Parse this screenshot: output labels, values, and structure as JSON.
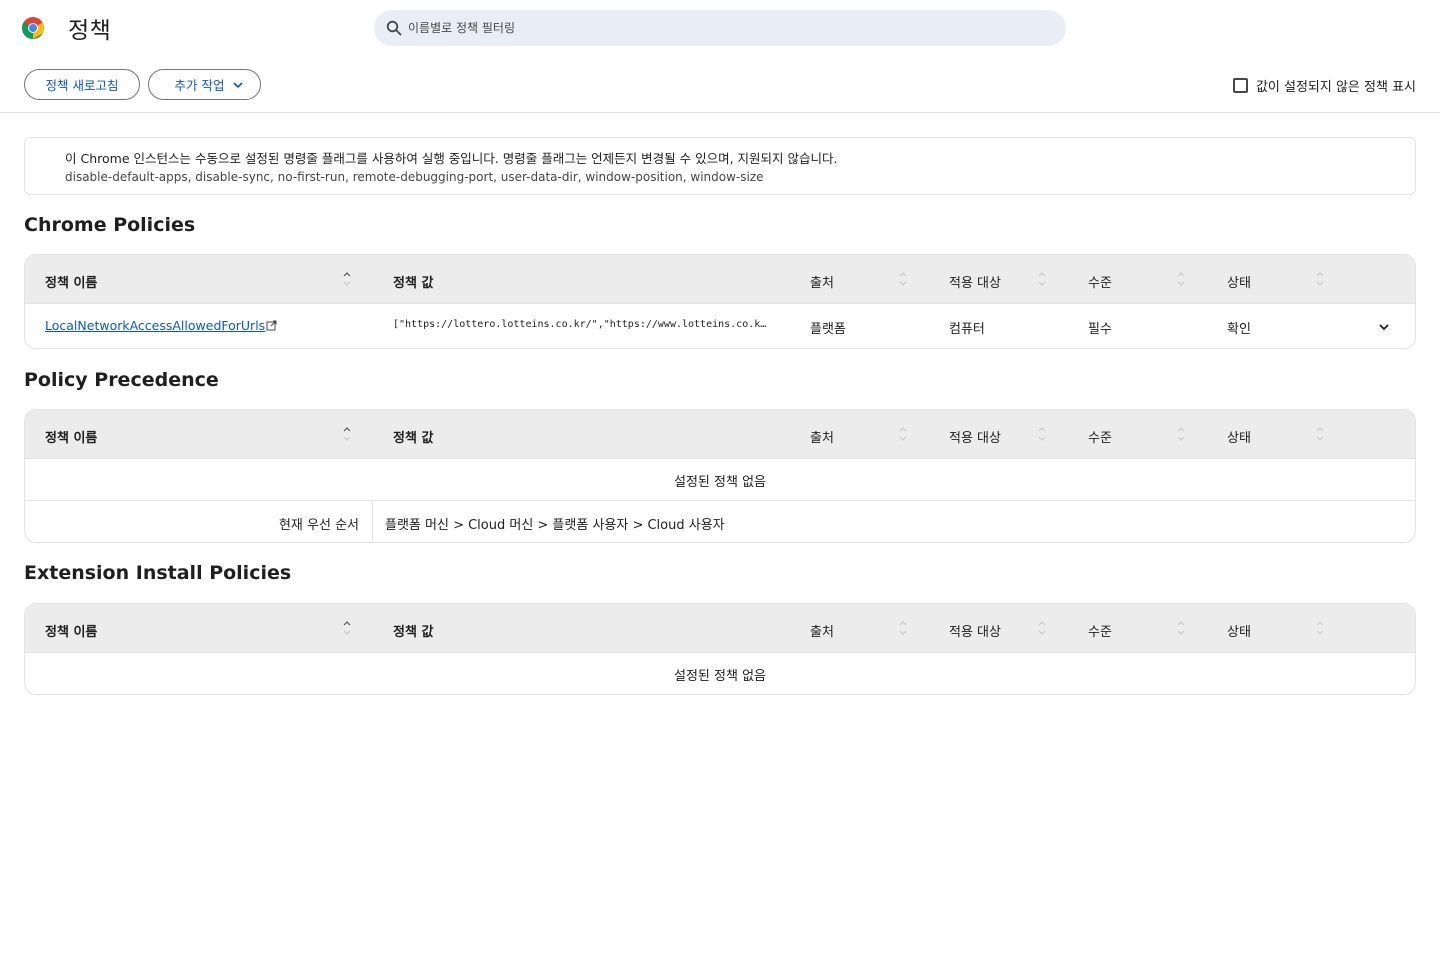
{
  "header": {
    "title": "정책",
    "search_placeholder": "이름별로 정책 필터링"
  },
  "toolbar": {
    "reload_label": "정책 새로고침",
    "more_label": "추가 작업",
    "show_unset_label": "값이 설정되지 않은 정책 표시",
    "show_unset_checked": false
  },
  "notice": {
    "line1": "이 Chrome 인스턴스는 수동으로 설정된 명령줄 플래그를 사용하여 실행 중입니다. 명령줄 플래그는 언제든지 변경될 수 있으며, 지원되지 않습니다.",
    "line2": "disable-default-apps, disable-sync, no-first-run, remote-debugging-port, user-data-dir, window-position, window-size"
  },
  "columns": {
    "name": "정책 이름",
    "value": "정책 값",
    "source": "출처",
    "scope": "적용 대상",
    "level": "수준",
    "status": "상태"
  },
  "chrome_policies": {
    "title": "Chrome Policies",
    "rows": [
      {
        "name": "LocalNetworkAccessAllowedForUrls",
        "value": "[\"https://lottero.lotteins.co.kr/\",\"https://www.lotteins.co.kr/\",\"htt…",
        "source": "플랫폼",
        "scope": "컴퓨터",
        "level": "필수",
        "status": "확인"
      }
    ]
  },
  "policy_precedence": {
    "title": "Policy Precedence",
    "empty_text": "설정된 정책 없음",
    "current_label": "현재 우선 순서",
    "current_value": "플랫폼 머신 > Cloud 머신 > 플랫폼 사용자 > Cloud 사용자"
  },
  "extension_install": {
    "title": "Extension Install Policies",
    "empty_text": "설정된 정책 없음"
  },
  "colors": {
    "accent": "#0b57d0",
    "search_bg": "#e9eef6",
    "table_header_bg": "#ececec",
    "border": "#e3e3e3"
  },
  "icons": [
    "chrome-logo",
    "search-icon",
    "chevron-down-icon",
    "sort-icon",
    "external-link-icon",
    "expand-icon"
  ]
}
